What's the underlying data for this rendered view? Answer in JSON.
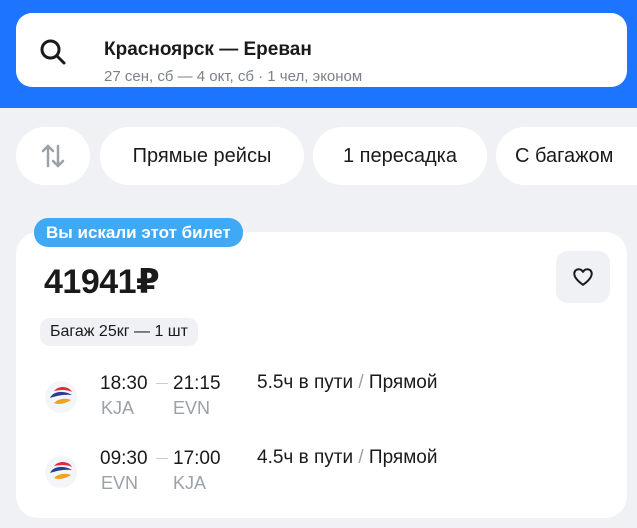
{
  "search": {
    "route": "Красноярск — Ереван",
    "details": "27 сен, сб — 4 окт, сб · 1 чел, эконом"
  },
  "filters": {
    "direct": "Прямые рейсы",
    "one_transfer": "1 пересадка",
    "baggage": "С багажом"
  },
  "ticket": {
    "badge": "Вы искали этот билет",
    "price": "41941₽",
    "baggage": "Багаж 25кг — 1 шт",
    "segments": [
      {
        "depart_time": "18:30",
        "arrive_time": "21:15",
        "from_code": "KJA",
        "to_code": "EVN",
        "duration": "5.5ч в пути",
        "separator": "/",
        "stops": "Прямой"
      },
      {
        "depart_time": "09:30",
        "arrive_time": "17:00",
        "from_code": "EVN",
        "to_code": "KJA",
        "duration": "4.5ч в пути",
        "separator": "/",
        "stops": "Прямой"
      }
    ]
  },
  "icons": {
    "search": "search-icon",
    "sort": "sort-arrows-icon",
    "favorite": "heart-icon",
    "airline": "airline-logo-icon"
  },
  "colors": {
    "header": "#1c74ff",
    "badge": "#3fa9f5",
    "background": "#eff1f4"
  }
}
